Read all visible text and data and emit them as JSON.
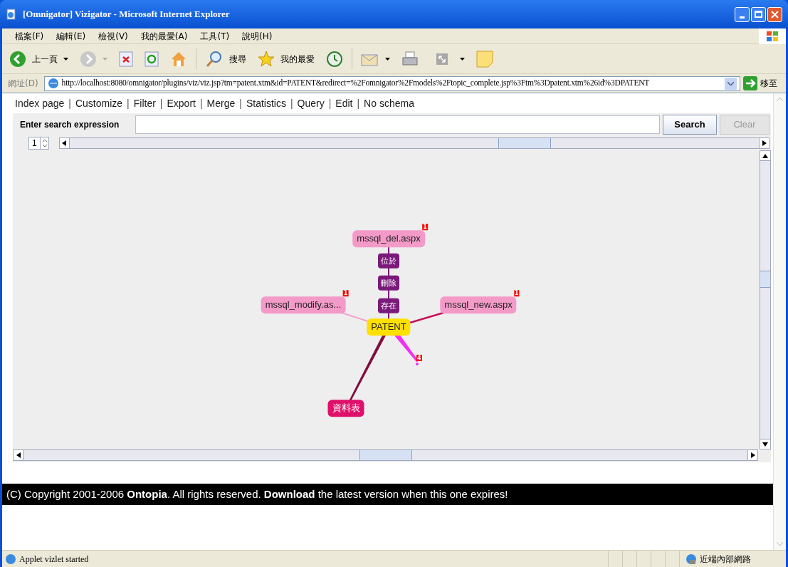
{
  "window": {
    "title": "[Omnigator] Vizigator - Microsoft Internet Explorer"
  },
  "menu": [
    "檔案(F)",
    "編輯(E)",
    "檢視(V)",
    "我的最愛(A)",
    "工具(T)",
    "說明(H)"
  ],
  "toolbar": {
    "back": "上一頁",
    "search": "搜尋",
    "favorites": "我的最愛"
  },
  "address": {
    "label": "網址(D)",
    "url": "http://localhost:8080/omnigator/plugins/viz/viz.jsp?tm=patent.xtm&id=PATENT&redirect=%2Fomnigator%2Fmodels%2Ftopic_complete.jsp%3Ftm%3Dpatent.xtm%26id%3DPATENT",
    "go": "移至"
  },
  "nav": [
    {
      "kind": "link",
      "text": "Index page"
    },
    {
      "kind": "separator",
      "text": "|"
    },
    {
      "kind": "link",
      "text": "Customize"
    },
    {
      "kind": "separator",
      "text": "|"
    },
    {
      "kind": "link",
      "text": "Filter"
    },
    {
      "kind": "separator",
      "text": "|"
    },
    {
      "kind": "link",
      "text": "Export"
    },
    {
      "kind": "separator",
      "text": "|"
    },
    {
      "kind": "link",
      "text": "Merge"
    },
    {
      "kind": "separator",
      "text": "|"
    },
    {
      "kind": "link",
      "text": "Statistics"
    },
    {
      "kind": "separator",
      "text": "|"
    },
    {
      "kind": "link",
      "text": "Query"
    },
    {
      "kind": "separator",
      "text": "|"
    },
    {
      "kind": "link",
      "text": "Edit"
    },
    {
      "kind": "separator",
      "text": "|"
    },
    {
      "kind": "link",
      "text": "No schema"
    }
  ],
  "search": {
    "label": "Enter search expression",
    "search_button": "Search",
    "clear_button": {
      "text": "Clear",
      "disabled": true
    }
  },
  "locality": "1",
  "graph": {
    "nodes": [
      {
        "kind": "topic",
        "label": "mssql_del.aspx",
        "badge": "1"
      },
      {
        "kind": "association",
        "label": "位於"
      },
      {
        "kind": "association",
        "label": "刪除"
      },
      {
        "kind": "topic",
        "label": "mssql_modify.as...",
        "badge": "1"
      },
      {
        "kind": "association",
        "label": "存在"
      },
      {
        "kind": "topic",
        "label": "mssql_new.aspx",
        "badge": "1"
      },
      {
        "kind": "focus",
        "label": "PATENT"
      },
      {
        "kind": "dot",
        "badge": "4"
      },
      {
        "kind": "type",
        "label": "資料表"
      }
    ]
  },
  "footer": "(C) Copyright 2001-2006 **Ontopia**. All rights reserved. **Download** the latest version when this one expires!",
  "status_bar": {
    "text": "Applet vizlet started",
    "zone": "近端內部網路"
  }
}
